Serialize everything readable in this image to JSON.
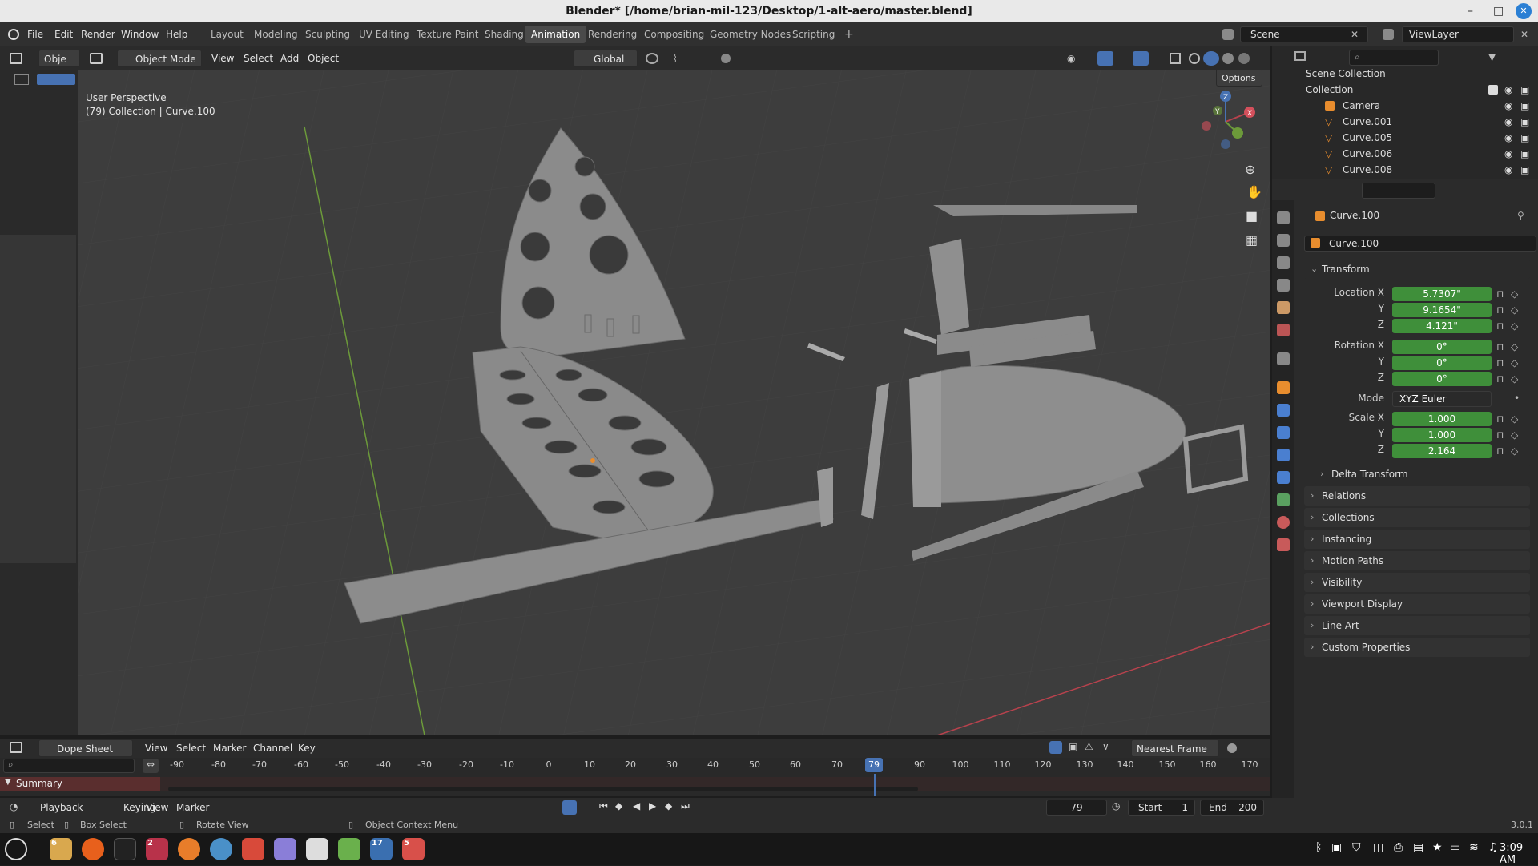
{
  "window": {
    "title": "Blender* [/home/brian-mil-123/Desktop/1-alt-aero/master.blend]",
    "minimize": "–",
    "maximize": "□",
    "close": "✕"
  },
  "topbar": {
    "menus": [
      "File",
      "Edit",
      "Render",
      "Window",
      "Help"
    ],
    "workspaces": [
      "Layout",
      "Modeling",
      "Sculpting",
      "UV Editing",
      "Texture Paint",
      "Shading",
      "Animation",
      "Rendering",
      "Compositing",
      "Geometry Nodes",
      "Scripting"
    ],
    "active_workspace": "Animation",
    "add_tab": "+",
    "scene": "Scene",
    "view_layer": "ViewLayer"
  },
  "viewport_header": {
    "editor_short": "Obje",
    "mode": "Object Mode",
    "menus": [
      "View",
      "Select",
      "Add",
      "Object"
    ],
    "orientation": "Global",
    "options": "Options"
  },
  "viewport": {
    "perspective": "User Perspective",
    "context": "(79) Collection | Curve.100",
    "gizmo_axes": {
      "x": "X",
      "y": "Y",
      "z": "Z"
    }
  },
  "outliner": {
    "root": "Scene Collection",
    "collection": "Collection",
    "items": [
      "Camera",
      "Curve.001",
      "Curve.005",
      "Curve.006",
      "Curve.008"
    ]
  },
  "properties": {
    "object_name": "Curve.100",
    "data_name": "Curve.100",
    "transform_title": "Transform",
    "location_label": "Location X",
    "rotation_label": "Rotation X",
    "scale_label": "Scale X",
    "y_label": "Y",
    "z_label": "Z",
    "location": [
      "5.7307\"",
      "9.1654\"",
      "4.121\""
    ],
    "rotation": [
      "0°",
      "0°",
      "0°"
    ],
    "mode_label": "Mode",
    "mode_value": "XYZ Euler",
    "scale": [
      "1.000",
      "1.000",
      "2.164"
    ],
    "delta_transform": "Delta Transform",
    "panels": [
      "Relations",
      "Collections",
      "Instancing",
      "Motion Paths",
      "Visibility",
      "Viewport Display",
      "Line Art",
      "Custom Properties"
    ]
  },
  "dopesheet": {
    "editor": "Dope Sheet",
    "menus": [
      "View",
      "Select",
      "Marker",
      "Channel",
      "Key"
    ],
    "snapping": "Nearest Frame",
    "ticks": [
      "-90",
      "-80",
      "-70",
      "-60",
      "-50",
      "-40",
      "-30",
      "-20",
      "-10",
      "0",
      "10",
      "20",
      "30",
      "40",
      "50",
      "60",
      "70",
      "79",
      "90",
      "100",
      "110",
      "120",
      "130",
      "140",
      "150",
      "160",
      "170"
    ],
    "current_frame": "79",
    "summary": "Summary"
  },
  "timeline": {
    "menus": [
      "Playback",
      "Keying",
      "View",
      "Marker"
    ],
    "frame": "79",
    "start_label": "Start",
    "start": "1",
    "end_label": "End",
    "end": "200"
  },
  "statusbar": {
    "select": "Select",
    "box_select": "Box Select",
    "rotate": "Rotate View",
    "context_menu": "Object Context Menu",
    "version": "3.0.1"
  },
  "taskbar": {
    "badges": [
      "6",
      "2",
      "17",
      "5"
    ],
    "clock": "3:09 AM"
  },
  "colors": {
    "accent_green": "#3f8f3a",
    "active_blue": "#4772b3",
    "object_orange": "#e88d2e"
  }
}
